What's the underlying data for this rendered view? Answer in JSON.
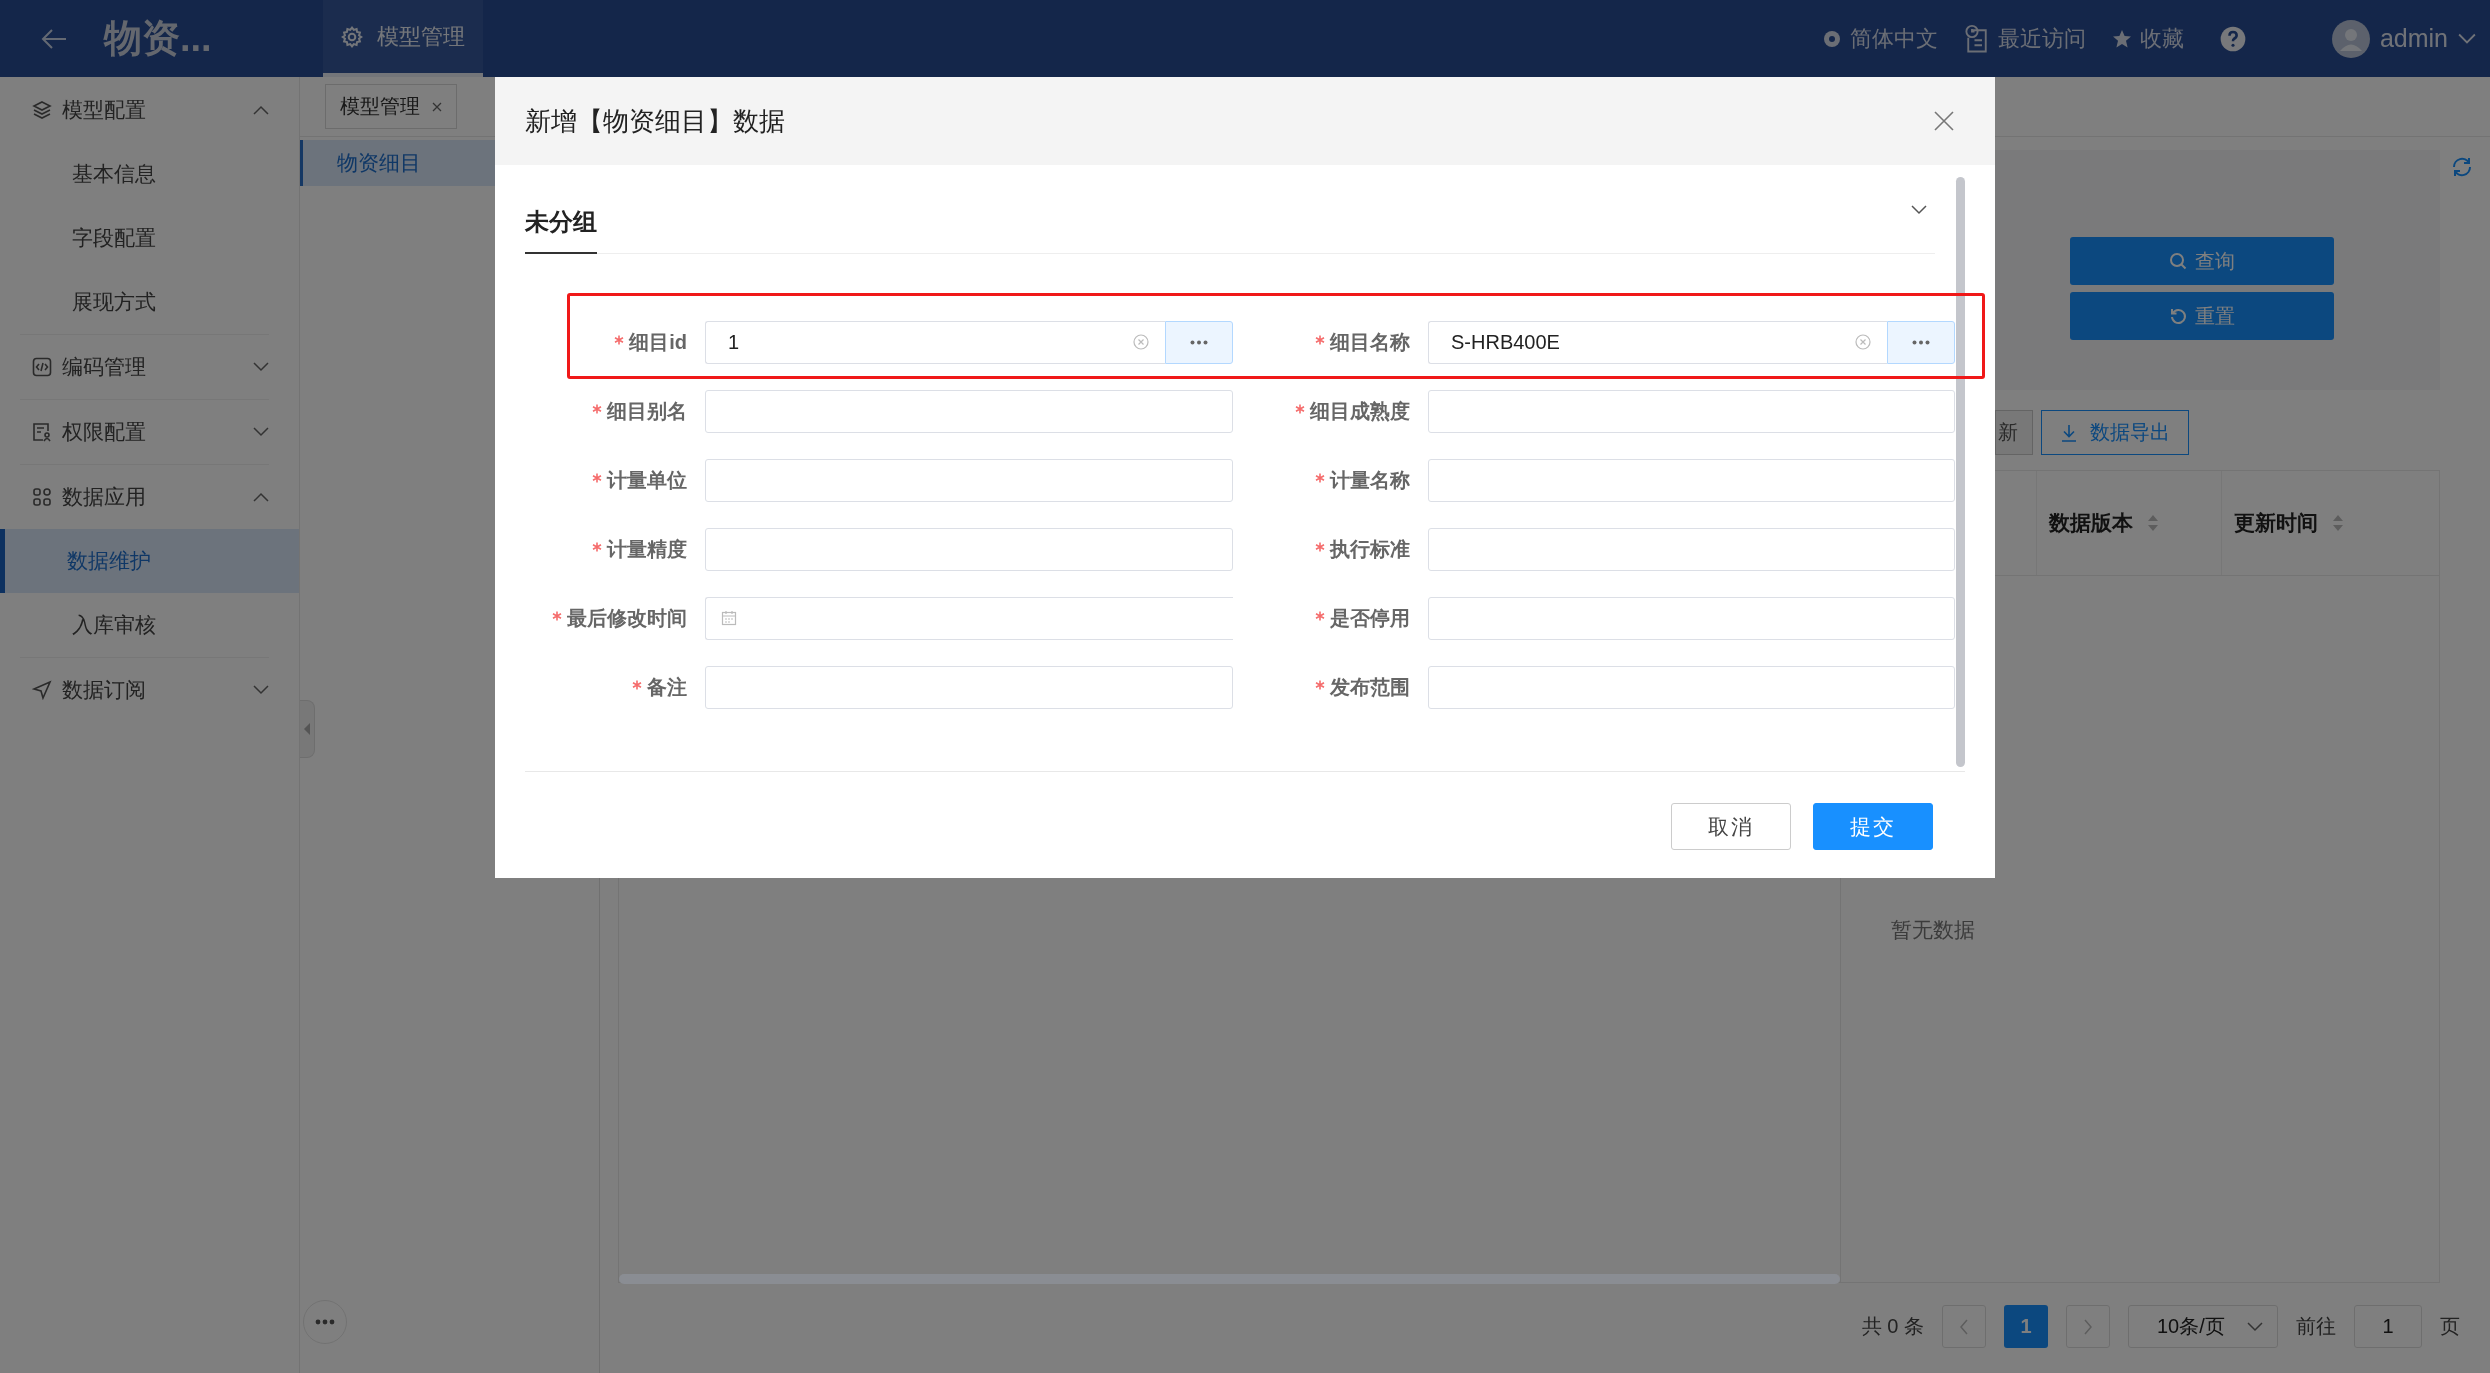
{
  "header": {
    "app_title": "物资...",
    "nav_tabs": [
      {
        "label": "模型管理",
        "selected": true
      }
    ],
    "tools": [
      {
        "kind": "language",
        "label": "简体中文"
      },
      {
        "kind": "recent",
        "label": "最近访问"
      },
      {
        "kind": "favorite",
        "label": "收藏"
      },
      {
        "kind": "help"
      }
    ],
    "user": "admin"
  },
  "sidebar": {
    "items": [
      {
        "kind": "model",
        "label": "模型配置",
        "expanded": true,
        "children": [
          {
            "label": "基本信息",
            "selected": false
          },
          {
            "label": "字段配置",
            "selected": false
          },
          {
            "label": "展现方式",
            "selected": false
          }
        ]
      },
      {
        "kind": "code",
        "label": "编码管理",
        "expanded": false
      },
      {
        "kind": "permission",
        "label": "权限配置",
        "expanded": false
      },
      {
        "kind": "apps",
        "label": "数据应用",
        "expanded": true,
        "children": [
          {
            "label": "数据维护",
            "selected": true
          },
          {
            "label": "入库审核",
            "selected": false
          }
        ]
      },
      {
        "kind": "subscribe",
        "label": "数据订阅",
        "expanded": false
      }
    ]
  },
  "page_tabs": [
    {
      "label": "模型管理",
      "selected": false
    }
  ],
  "tree": [
    {
      "label": "物资细目",
      "selected": true
    }
  ],
  "search_buttons": [
    {
      "kind": "search",
      "label": "查询"
    },
    {
      "kind": "reset",
      "label": "重置"
    }
  ],
  "toolbar": [
    {
      "kind": "plain",
      "label": "新"
    },
    {
      "kind": "export",
      "label": "数据导出"
    }
  ],
  "table": {
    "columns": [
      "数据版本",
      "更新时间"
    ],
    "empty_text": "暂无数据"
  },
  "pagination": {
    "total": "共 0 条",
    "pages": [
      {
        "label": "1",
        "selected": true
      }
    ],
    "page_size": "10条/页",
    "goto_label": "前往",
    "goto_value": "1",
    "page_unit": "页"
  },
  "dialog": {
    "title": "新增【物资细目】数据",
    "group": {
      "label": "未分组",
      "expanded": true
    },
    "rows": [
      {
        "highlighted": true,
        "fields": [
          {
            "label": "细目id",
            "required": true,
            "kind": "lookup",
            "value": "1"
          },
          {
            "label": "细目名称",
            "required": true,
            "kind": "lookup",
            "value": "S-HRB400E"
          }
        ]
      },
      {
        "highlighted": false,
        "fields": [
          {
            "label": "细目别名",
            "required": true,
            "kind": "text"
          },
          {
            "label": "细目成熟度",
            "required": true,
            "kind": "text"
          }
        ]
      },
      {
        "highlighted": false,
        "fields": [
          {
            "label": "计量单位",
            "required": true,
            "kind": "text"
          },
          {
            "label": "计量名称",
            "required": true,
            "kind": "text"
          }
        ]
      },
      {
        "highlighted": false,
        "fields": [
          {
            "label": "计量精度",
            "required": true,
            "kind": "text"
          },
          {
            "label": "执行标准",
            "required": true,
            "kind": "text"
          }
        ]
      },
      {
        "highlighted": false,
        "fields": [
          {
            "label": "最后修改时间",
            "required": true,
            "kind": "date"
          },
          {
            "label": "是否停用",
            "required": true,
            "kind": "text"
          }
        ]
      },
      {
        "highlighted": false,
        "fields": [
          {
            "label": "备注",
            "required": true,
            "kind": "text"
          },
          {
            "label": "发布范围",
            "required": true,
            "kind": "text"
          }
        ]
      }
    ],
    "buttons": [
      {
        "kind": "secondary",
        "label": "取消"
      },
      {
        "kind": "primary",
        "label": "提交"
      }
    ]
  }
}
